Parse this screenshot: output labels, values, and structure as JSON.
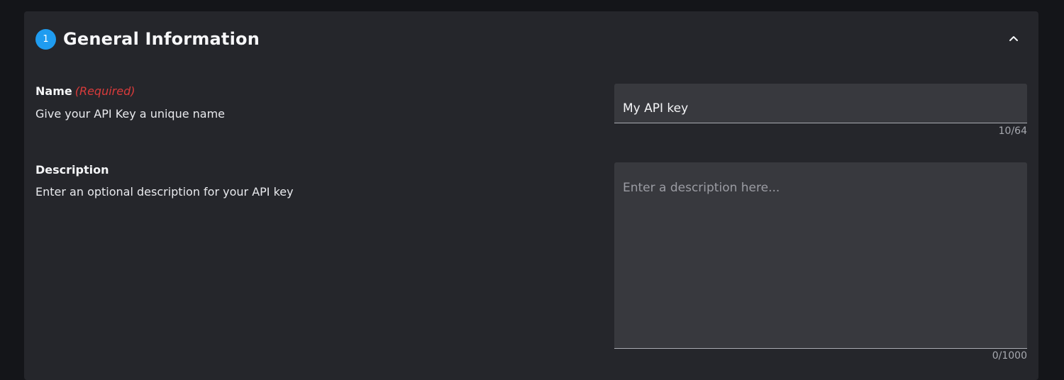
{
  "section": {
    "step_number": "1",
    "title": "General Information",
    "collapse_icon": "chevron-up-icon"
  },
  "name_field": {
    "label": "Name",
    "required_text": "(Required)",
    "help": "Give your API Key a unique name",
    "value": "My API key",
    "counter": "10/64"
  },
  "description_field": {
    "label": "Description",
    "help": "Enter an optional description for your API key",
    "placeholder": "Enter a description here...",
    "counter": "0/1000"
  },
  "colors": {
    "page_background": "#141519",
    "panel_background": "#25262b",
    "input_background": "#38393e",
    "accent_blue": "#1f9cf0",
    "required_red": "#d93b3b"
  }
}
